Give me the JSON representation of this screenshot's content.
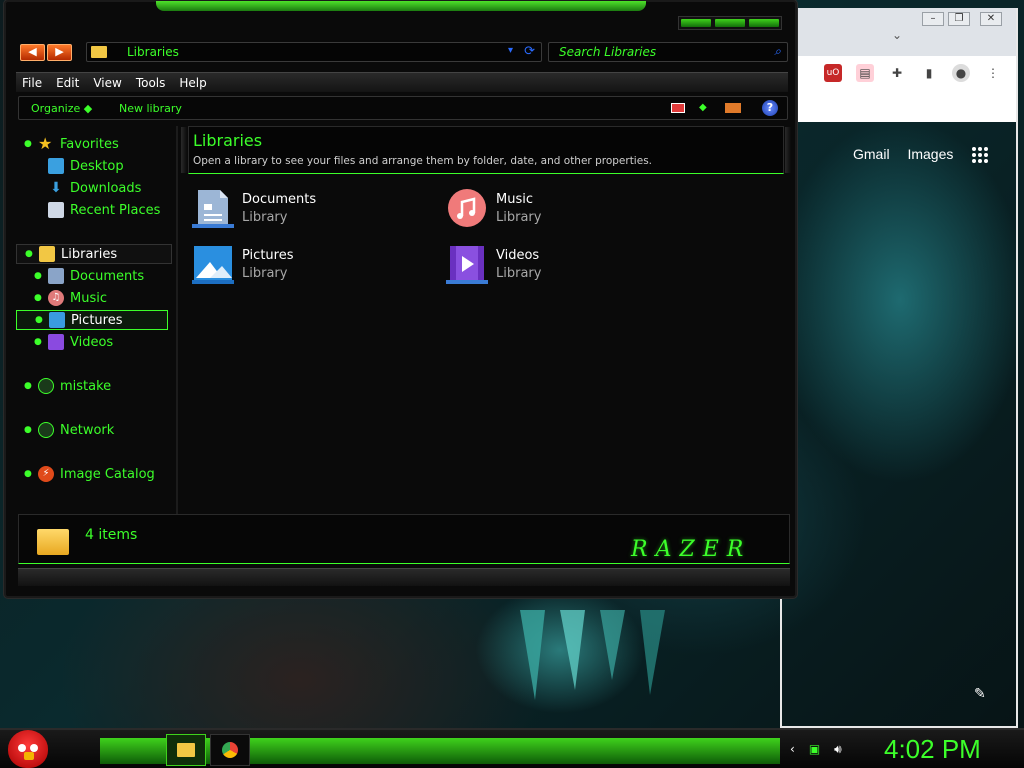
{
  "explorer": {
    "address": "Libraries",
    "search_placeholder": "Search Libraries",
    "menu": [
      "File",
      "Edit",
      "View",
      "Tools",
      "Help"
    ],
    "toolbar": {
      "organize": "Organize",
      "new_library": "New library",
      "help_glyph": "?"
    },
    "nav": {
      "favorites": "Favorites",
      "desktop": "Desktop",
      "downloads": "Downloads",
      "recent": "Recent Places",
      "libraries": "Libraries",
      "documents": "Documents",
      "music": "Music",
      "pictures": "Pictures",
      "videos": "Videos",
      "mistake": "mistake",
      "network": "Network",
      "image_catalog": "Image Catalog"
    },
    "content": {
      "title": "Libraries",
      "subtitle": "Open a library to see your files and arrange them by folder, date, and other properties.",
      "libraries": [
        {
          "name": "Documents",
          "kind": "Library"
        },
        {
          "name": "Music",
          "kind": "Library"
        },
        {
          "name": "Pictures",
          "kind": "Library"
        },
        {
          "name": "Videos",
          "kind": "Library"
        }
      ]
    },
    "status": {
      "items": "4 items",
      "brand": "RAZER"
    }
  },
  "chrome": {
    "links": {
      "gmail": "Gmail",
      "images": "Images"
    }
  },
  "taskbar": {
    "clock": "4:02 PM"
  },
  "colors": {
    "accent": "#3cff2a",
    "bg": "#0a0a0a",
    "nav_arrows": "#ff7a2a"
  }
}
